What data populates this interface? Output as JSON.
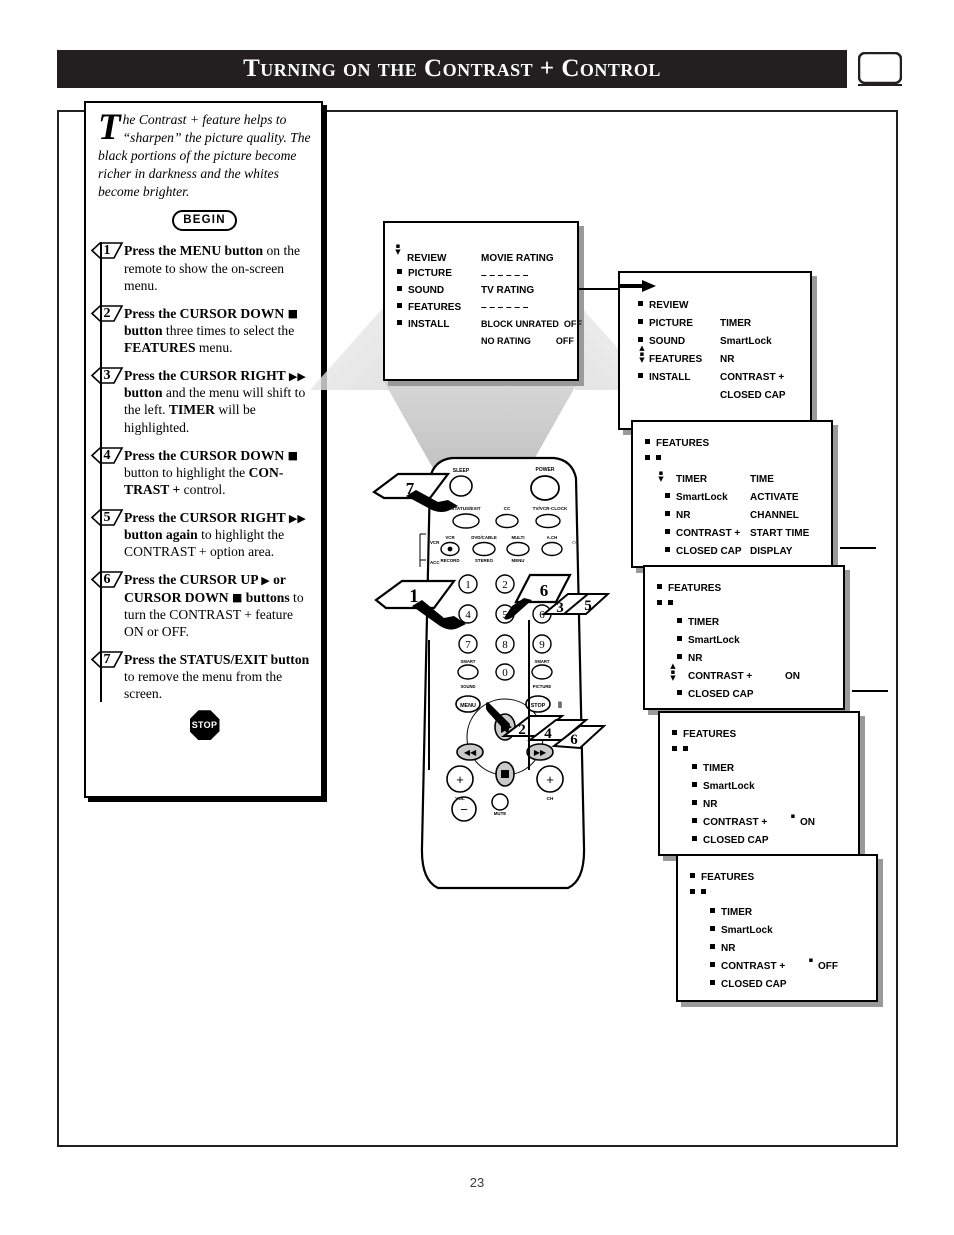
{
  "header": {
    "title": "Turning on the Contrast + Control",
    "corner_icon": "tv-screen-icon"
  },
  "page_number": "23",
  "instructions": {
    "intro_dropcap": "T",
    "intro_text": "he Contrast + feature helps to “sharpen” the picture quality. The black portions of the picture become richer in darkness and the whites become brighter.",
    "begin_label": "BEGIN",
    "stop_label": "STOP",
    "steps": [
      {
        "num": "1",
        "html": "<b>Press the MENU button</b> on the remote to show the on-screen menu."
      },
      {
        "num": "2",
        "html": "<b>Press the CURSOR DOWN <span class=\"sq\">■</span> button</b> three times to select the <b>FEATURES</b> menu."
      },
      {
        "num": "3",
        "html": "<b>Press the CURSOR RIGHT <span class=\"tri\">▶▶</span> button</b> and the menu will shift to the left. <b>TIMER</b> will be highlighted."
      },
      {
        "num": "4",
        "html": "<b>Press the CURSOR DOWN <span class=\"sq\">■</span></b> button to highlight the <b>CON-TRAST +</b> control."
      },
      {
        "num": "5",
        "html": "<b>Press the CURSOR RIGHT <span class=\"tri\">▶▶</span> button again</b> to highlight the CONTRAST + option area."
      },
      {
        "num": "6",
        "html": "<b>Press the CURSOR UP <span class=\"tri\">▶</span> or CURSOR DOWN <span class=\"sq\">■</span> buttons</b> to turn the CONTRAST + feature ON or OFF."
      },
      {
        "num": "7",
        "html": "<b>Press the STATUS/EXIT button</b> to remove the menu from the screen."
      }
    ]
  },
  "osd_screens": [
    {
      "id": "osd-main-ratings",
      "left_items": [
        "REVIEW",
        "PICTURE",
        "SOUND",
        "FEATURES",
        "INSTALL"
      ],
      "right_items": [
        {
          "label": "MOVIE RATING",
          "value": ""
        },
        {
          "label": "– – – – – –",
          "value": ""
        },
        {
          "label": "TV RATING",
          "value": ""
        },
        {
          "label": "– – – – – –",
          "value": ""
        },
        {
          "label": "BLOCK UNRATED",
          "value": "OFF"
        },
        {
          "label": "NO RATING",
          "value": "OFF"
        }
      ],
      "cursor_on": "REVIEW"
    },
    {
      "id": "osd-features-list",
      "left_items": [
        "REVIEW",
        "PICTURE",
        "SOUND",
        "FEATURES",
        "INSTALL"
      ],
      "right_items": [
        {
          "label": "",
          "value": ""
        },
        {
          "label": "TIMER",
          "value": ""
        },
        {
          "label": "SmartLock",
          "value": ""
        },
        {
          "label": "NR",
          "value": ""
        },
        {
          "label": "CONTRAST +",
          "value": ""
        },
        {
          "label": "CLOSED CAP",
          "value": ""
        }
      ],
      "cursor_on": "FEATURES"
    },
    {
      "id": "osd-timer-highlighted",
      "title": "FEATURES",
      "sub_bullets": true,
      "left_items": [
        "TIMER",
        "SmartLock",
        "NR",
        "CONTRAST +",
        "CLOSED CAP"
      ],
      "right_items": [
        "TIME",
        "ACTIVATE",
        "CHANNEL",
        "START TIME",
        "DISPLAY"
      ],
      "cursor_on": "TIMER"
    },
    {
      "id": "osd-contrast-on-1",
      "title": "FEATURES",
      "sub_bullets": true,
      "left_items": [
        "TIMER",
        "SmartLock",
        "NR",
        "CONTRAST +",
        "CLOSED CAP"
      ],
      "right_items": [
        "",
        "",
        "",
        "ON",
        ""
      ],
      "cursor_on": "CONTRAST +"
    },
    {
      "id": "osd-contrast-on-2",
      "title": "FEATURES",
      "sub_bullets": true,
      "left_items": [
        "TIMER",
        "SmartLock",
        "NR",
        "CONTRAST +",
        "CLOSED CAP"
      ],
      "right_items": [
        "",
        "",
        "",
        "ON",
        ""
      ],
      "cursor_on": "option-area"
    },
    {
      "id": "osd-contrast-off",
      "title": "FEATURES",
      "sub_bullets": true,
      "left_items": [
        "TIMER",
        "SmartLock",
        "NR",
        "CONTRAST +",
        "CLOSED CAP"
      ],
      "right_items": [
        "",
        "",
        "",
        "OFF",
        ""
      ],
      "cursor_on": "option-area"
    }
  ],
  "remote": {
    "name": "tv-remote-control",
    "top_buttons": [
      "SLEEP",
      "POWER"
    ],
    "row2": [
      "STATUS/EXIT",
      "CC",
      "TV/VCR·CLOCK"
    ],
    "row3": [
      "VCR",
      "DVD/CABLE",
      "MULTI",
      "A.CH"
    ],
    "row3_sub": [
      "RECORD",
      "STEREO",
      "MENU"
    ],
    "source_labels": [
      "VCR",
      "ACC"
    ],
    "keypad": [
      "1",
      "2",
      "3",
      "4",
      "5",
      "6",
      "7",
      "8",
      "9",
      "0"
    ],
    "smart_labels": [
      "SMART",
      "SOUND",
      "SMART",
      "PICTURE"
    ],
    "transport": [
      "MENU",
      "STOP",
      "PAUSE",
      "PLAY",
      "REW",
      "FFWD"
    ],
    "bottom": [
      "VOL",
      "CH",
      "MUTE"
    ],
    "callouts": [
      "7",
      "1",
      "6",
      "3",
      "5",
      "2",
      "4",
      "6"
    ]
  }
}
